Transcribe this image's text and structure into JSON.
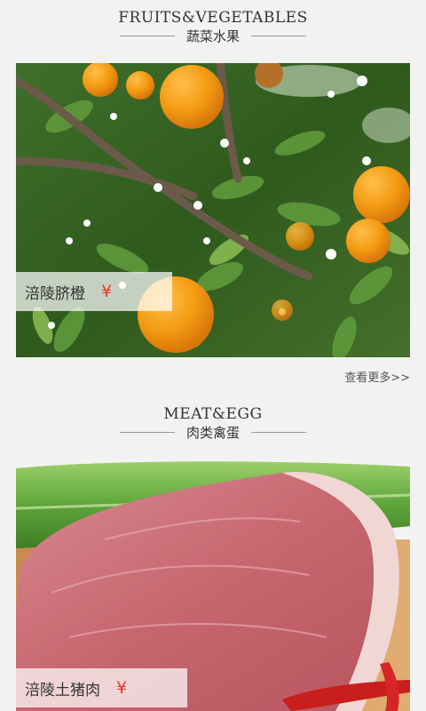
{
  "fruit_section": {
    "title_en": "FRUITS&VEGETABLES",
    "title_cn": "蔬菜水果",
    "product_name": "涪陵脐橙",
    "price_symbol": "¥",
    "more_link": "查看更多>>"
  },
  "meat_section": {
    "title_en": "MEAT&EGG",
    "title_cn": "肉类禽蛋",
    "product_name": "涪陵土猪肉",
    "price_symbol": "¥"
  },
  "colors": {
    "accent": "#e53b2c",
    "background": "#f2f2f2"
  }
}
